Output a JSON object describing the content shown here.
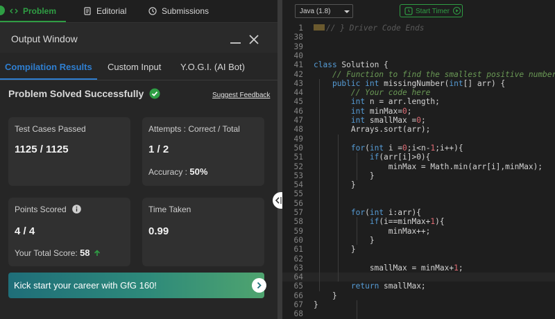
{
  "nav": {
    "tabs": [
      {
        "label": "Problem",
        "icon": "code-icon"
      },
      {
        "label": "Editorial",
        "icon": "document-icon"
      },
      {
        "label": "Submissions",
        "icon": "clock-icon"
      }
    ],
    "active_color": "#2f9e44"
  },
  "output": {
    "title": "Output Window",
    "tabs": [
      "Compilation Results",
      "Custom Input",
      "Y.O.G.I. (AI Bot)"
    ],
    "active_tab_color": "#2f7fd1",
    "status": "Problem Solved Successfully",
    "feedback_link": "Suggest Feedback",
    "cards": {
      "test_cases": {
        "label": "Test Cases Passed",
        "value": "1125 / 1125"
      },
      "attempts": {
        "label": "Attempts : Correct / Total",
        "value": "1 / 2",
        "accuracy_label": "Accuracy :",
        "accuracy_value": "50%"
      },
      "points": {
        "label": "Points Scored",
        "value": "4 / 4",
        "total_label": "Your Total Score:",
        "total_value": "58"
      },
      "time": {
        "label": "Time Taken",
        "value": "0.99"
      }
    },
    "banner": "Kick start your career with GfG 160!"
  },
  "editor": {
    "language": "Java (1.8)",
    "timer_label": "Start Timer",
    "lines": [
      {
        "n": "1",
        "t": "// } Driver Code Ends"
      },
      {
        "n": "38",
        "t": ""
      },
      {
        "n": "39",
        "t": ""
      },
      {
        "n": "40",
        "t": ""
      },
      {
        "n": "41",
        "t": "class Solution {"
      },
      {
        "n": "42",
        "t": "    // Function to find the smallest positive number mi"
      },
      {
        "n": "43",
        "t": "    public int missingNumber(int[] arr) {"
      },
      {
        "n": "44",
        "t": "        // Your code here"
      },
      {
        "n": "45",
        "t": "        int n = arr.length;"
      },
      {
        "n": "46",
        "t": "        int minMax=0;"
      },
      {
        "n": "47",
        "t": "        int smallMax =0;"
      },
      {
        "n": "48",
        "t": "        Arrays.sort(arr);"
      },
      {
        "n": "49",
        "t": ""
      },
      {
        "n": "50",
        "t": "        for(int i =0;i<n-1;i++){"
      },
      {
        "n": "51",
        "t": "            if(arr[i]>0){"
      },
      {
        "n": "52",
        "t": "                minMax = Math.min(arr[i],minMax);"
      },
      {
        "n": "53",
        "t": "            }"
      },
      {
        "n": "54",
        "t": "        }"
      },
      {
        "n": "55",
        "t": ""
      },
      {
        "n": "56",
        "t": ""
      },
      {
        "n": "57",
        "t": "        for(int i:arr){"
      },
      {
        "n": "58",
        "t": "            if(i==minMax+1){"
      },
      {
        "n": "59",
        "t": "                minMax++;"
      },
      {
        "n": "60",
        "t": "            }"
      },
      {
        "n": "61",
        "t": "        }"
      },
      {
        "n": "62",
        "t": ""
      },
      {
        "n": "63",
        "t": "            smallMax = minMax+1;"
      },
      {
        "n": "64",
        "t": ""
      },
      {
        "n": "65",
        "t": "        return smallMax;"
      },
      {
        "n": "66",
        "t": "    }"
      },
      {
        "n": "67",
        "t": "}"
      },
      {
        "n": "68",
        "t": ""
      }
    ]
  }
}
